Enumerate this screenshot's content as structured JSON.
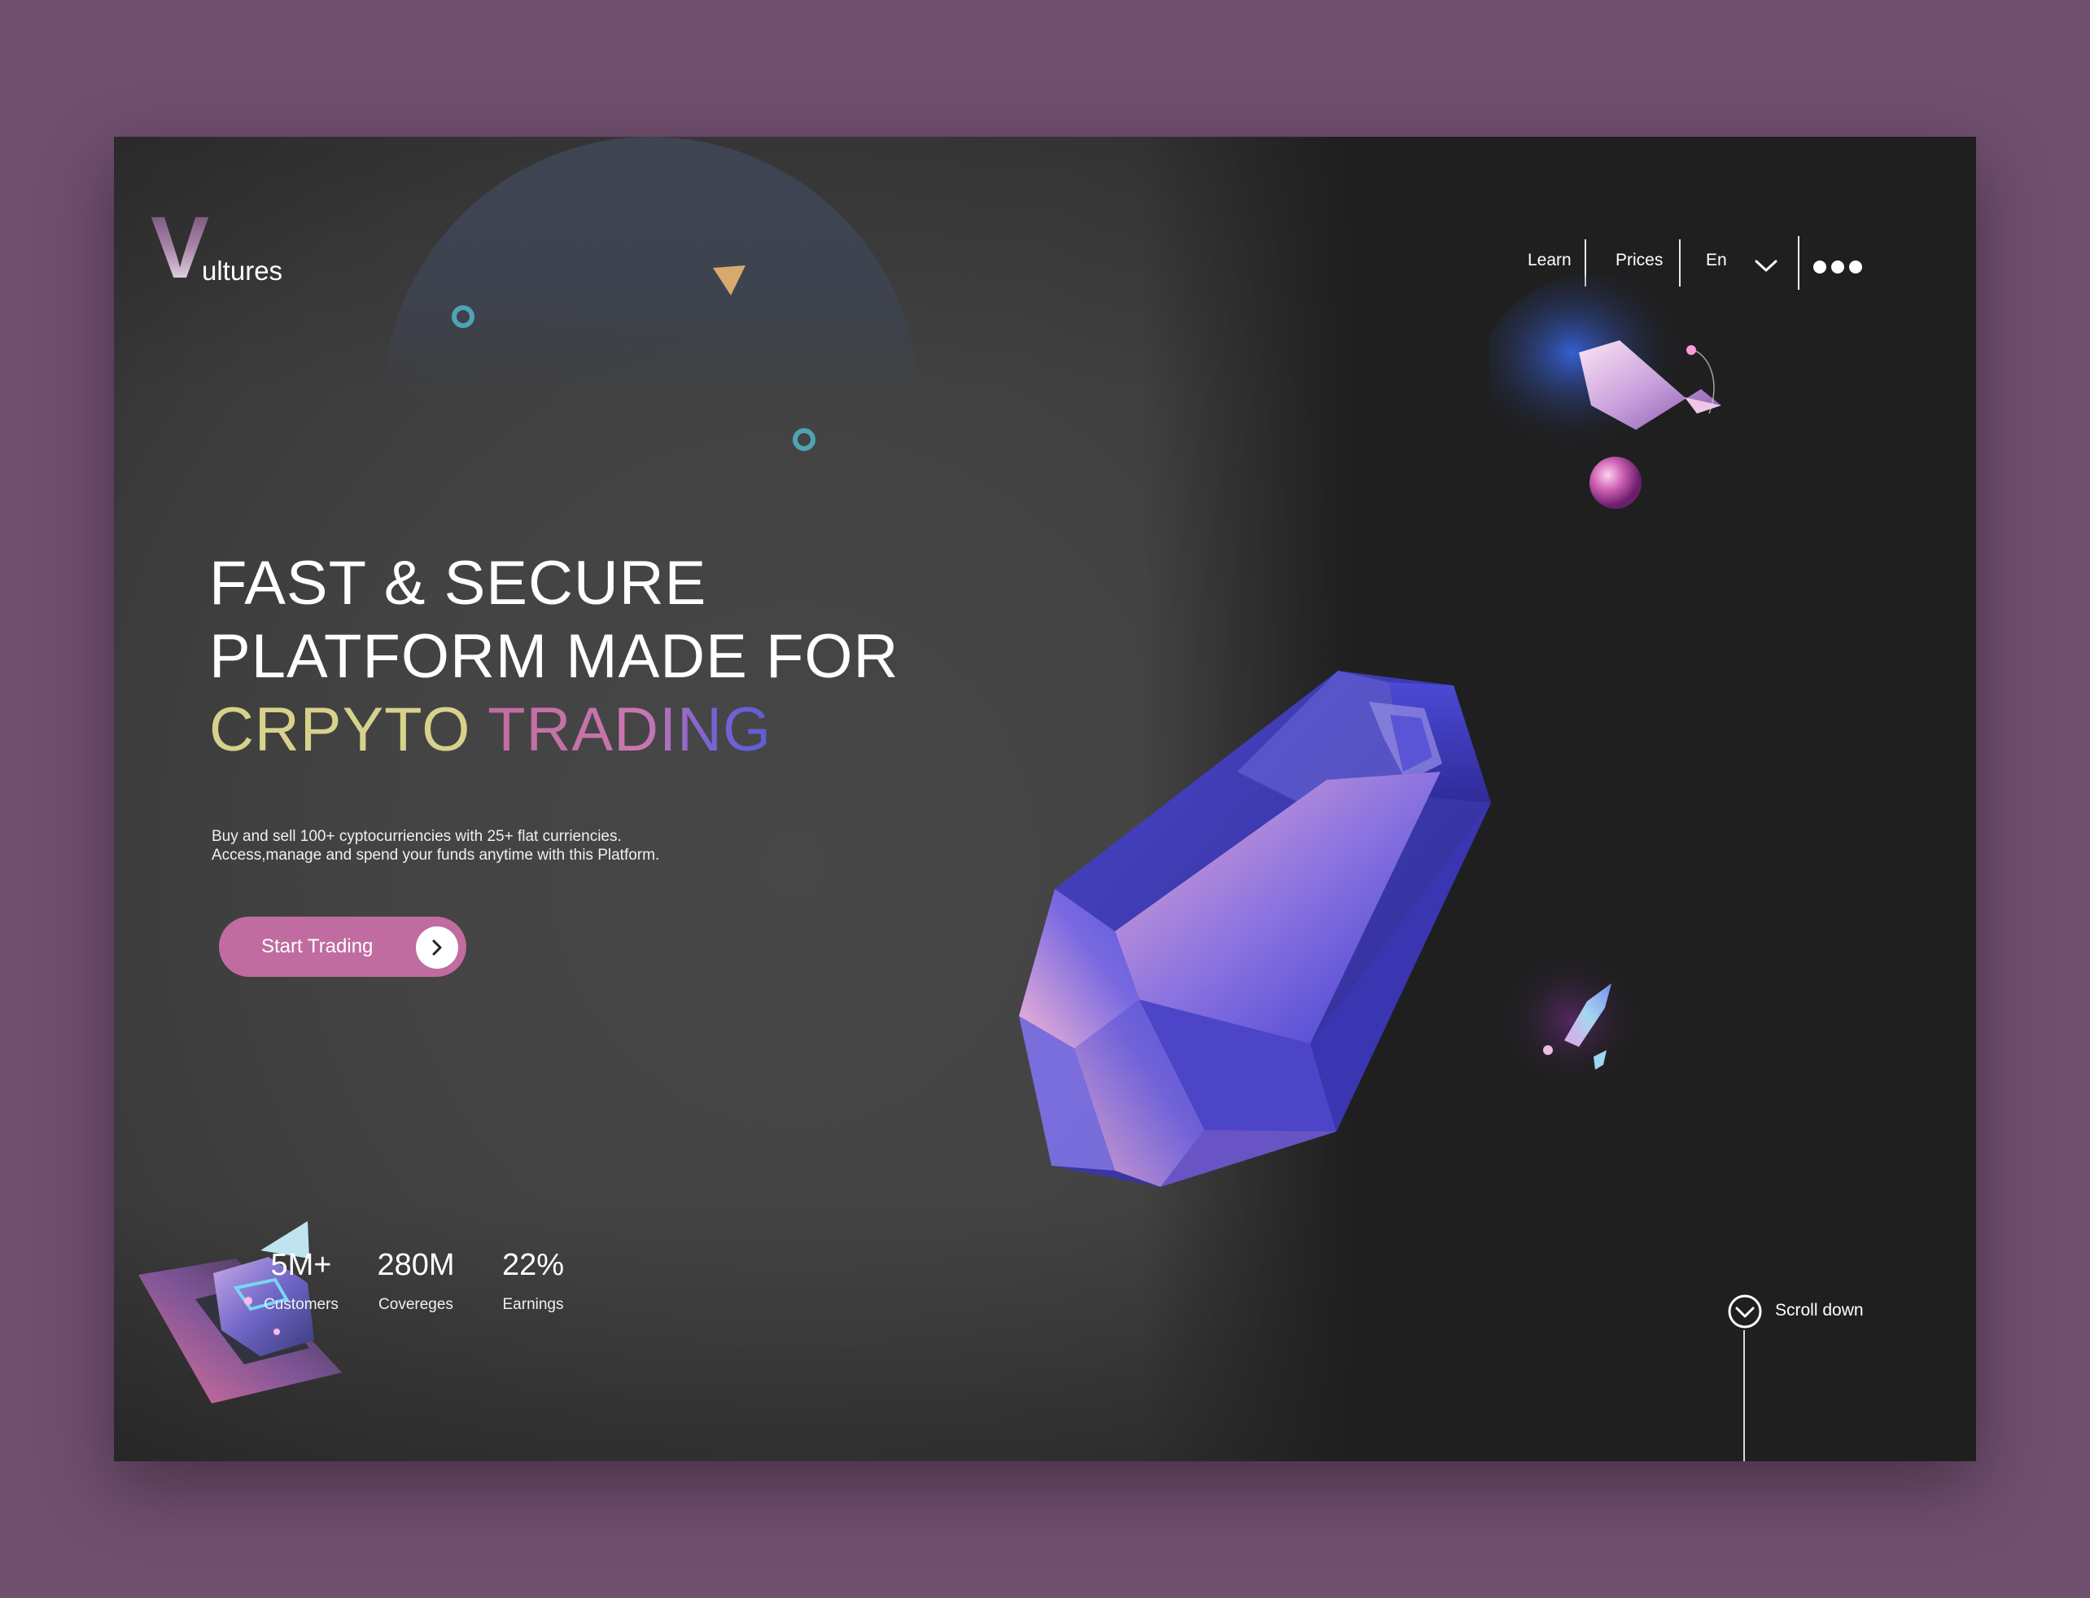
{
  "brand": {
    "initial": "V",
    "rest": "ultures"
  },
  "nav": {
    "items": [
      "Learn",
      "Prices"
    ],
    "language": "En",
    "more_icon": "more-dots-icon"
  },
  "hero": {
    "title_line1": "FAST & SECURE",
    "title_line2": "PLATFORM MADE FOR",
    "title_word_a": "CRPYTO",
    "title_word_b": "TRADING",
    "description": "Buy and sell 100+ cyptocurriencies with 25+ flat curriencies. Access,manage and spend your funds anytime with this Platform.",
    "cta_label": "Start Trading"
  },
  "stats": [
    {
      "value": "5M+",
      "label": "Customers"
    },
    {
      "value": "280M",
      "label": "Covereges"
    },
    {
      "value": "22%",
      "label": "Earnings"
    }
  ],
  "scroll": {
    "label": "Scroll down"
  },
  "colors": {
    "page_bg": "#6f4e6e",
    "accent_pink": "#c06ca0",
    "accent_yellow": "#d7d28b",
    "ring_teal": "#4fa3b4",
    "triangle_gold": "#d6aa6c"
  }
}
